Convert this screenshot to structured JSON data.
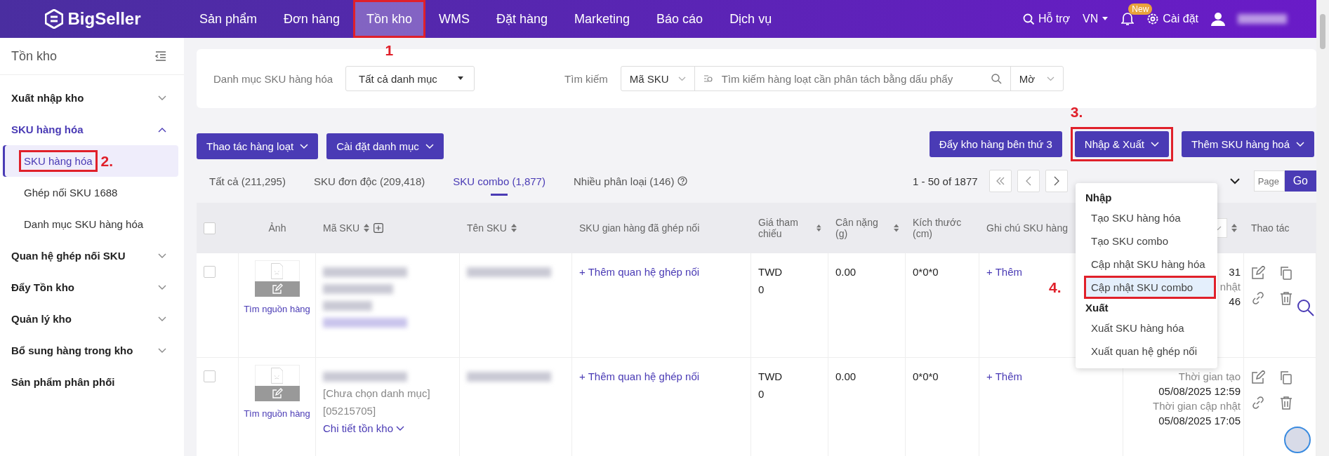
{
  "topbar": {
    "logo": "BigSeller",
    "nav": [
      {
        "label": "Sản phẩm",
        "selected": false
      },
      {
        "label": "Đơn hàng",
        "selected": false
      },
      {
        "label": "Tồn kho",
        "selected": true,
        "callout": "1"
      },
      {
        "label": "WMS",
        "selected": false
      },
      {
        "label": "Đặt hàng",
        "selected": false
      },
      {
        "label": "Marketing",
        "selected": false
      },
      {
        "label": "Báo cáo",
        "selected": false
      },
      {
        "label": "Dịch vụ",
        "selected": false
      }
    ],
    "help": "Hỗ trợ",
    "language": "VN",
    "badge": "New",
    "settings": "Cài đặt"
  },
  "sidebar": {
    "title": "Tồn kho",
    "items": [
      {
        "kind": "group",
        "label": "Xuất nhập kho",
        "expanded": false
      },
      {
        "kind": "group",
        "label": "SKU hàng hóa",
        "expanded": true,
        "children": [
          {
            "label": "SKU hàng hóa",
            "selected": true,
            "callout": "2."
          },
          {
            "label": "Ghép nối SKU 1688",
            "selected": false
          },
          {
            "label": "Danh mục SKU hàng hóa",
            "selected": false
          }
        ]
      },
      {
        "kind": "group",
        "label": "Quan hệ ghép nối SKU",
        "expanded": false
      },
      {
        "kind": "group",
        "label": "Đẩy Tồn kho",
        "expanded": false
      },
      {
        "kind": "group",
        "label": "Quản lý kho",
        "expanded": false
      },
      {
        "kind": "group",
        "label": "Bổ sung hàng trong kho",
        "expanded": false
      },
      {
        "kind": "link",
        "label": "Sản phẩm phân phối",
        "expanded": false
      }
    ]
  },
  "filters": {
    "category_label": "Danh mục SKU hàng hóa",
    "category_value": "Tất cả danh mục",
    "search_label": "Tìm kiếm",
    "search_type": "Mã SKU",
    "search_placeholder": "Tìm kiếm hàng loạt cần phân tách bằng dấu phẩy",
    "match_mode": "Mờ"
  },
  "toolbar": {
    "left": [
      {
        "label": "Thao tác hàng loạt"
      },
      {
        "label": "Cài đặt danh mục"
      }
    ],
    "right": [
      {
        "label": "Đẩy kho hàng bên thứ 3",
        "dropdown": false
      },
      {
        "label": "Nhập & Xuất",
        "dropdown": true,
        "callout": "3."
      },
      {
        "label": "Thêm SKU hàng hoá",
        "dropdown": true
      }
    ]
  },
  "tabs": [
    {
      "label": "Tất cả (211,295)",
      "selected": false,
      "help": false
    },
    {
      "label": "SKU đơn độc (209,418)",
      "selected": false,
      "help": false
    },
    {
      "label": "SKU combo (1,877)",
      "selected": true,
      "help": false
    },
    {
      "label": "Nhiều phân loại (146)",
      "selected": false,
      "help": true
    }
  ],
  "pagination": {
    "range": "1 - 50 of 1877",
    "page_placeholder": "Page",
    "go": "Go"
  },
  "menu": {
    "sections": [
      {
        "title": "Nhập",
        "items": [
          {
            "label": "Tạo SKU hàng hóa",
            "hovered": false
          },
          {
            "label": "Tạo SKU combo",
            "hovered": false
          },
          {
            "label": "Cập nhật SKU hàng hóa",
            "hovered": false
          },
          {
            "label": "Cập nhật SKU combo",
            "hovered": true,
            "callout": "4."
          }
        ]
      },
      {
        "title": "Xuất",
        "items": [
          {
            "label": "Xuất SKU hàng hóa",
            "hovered": false
          },
          {
            "label": "Xuất quan hệ ghép nối",
            "hovered": false
          }
        ]
      }
    ]
  },
  "table": {
    "all_checked": false,
    "columns": [
      {
        "label": "Ảnh",
        "sortable": false
      },
      {
        "label": "Mã SKU",
        "sortable": true
      },
      {
        "label": "Tên SKU",
        "sortable": true
      },
      {
        "label": "SKU gian hàng đã ghép nối",
        "sortable": false
      },
      {
        "label": "Giá tham chiếu",
        "sortable": true
      },
      {
        "label": "Cân nặng (g)",
        "sortable": true
      },
      {
        "label": "Kích thước (cm)",
        "sortable": false
      },
      {
        "label": "Ghi chú SKU hàng",
        "sortable": false
      },
      {
        "sortable": true
      },
      {
        "label": "Thao tác",
        "sortable": false
      }
    ],
    "rows": [
      {
        "checked": false,
        "image_link": "Tìm nguồn hàng",
        "link": "+ Thêm quan hệ ghép nối",
        "currency": "TWD",
        "price": "0",
        "weight": "0.00",
        "size": "0*0*0",
        "note": "+ Thêm",
        "times": [
          {
            "kind": "value",
            "text": "31"
          },
          {
            "kind": "label",
            "text": "nhật"
          },
          {
            "kind": "value",
            "text": "46"
          }
        ]
      },
      {
        "checked": false,
        "image_link": "Tìm nguồn hàng",
        "sku_lines": [
          "[Chưa chọn danh mục]",
          "[05215705]"
        ],
        "stock_link": "Chi tiết tồn kho",
        "link": "+ Thêm quan hệ ghép nối",
        "currency": "TWD",
        "price": "0",
        "weight": "0.00",
        "size": "0*0*0",
        "note": "+ Thêm",
        "times": [
          {
            "kind": "label",
            "text": "Thời gian tạo"
          },
          {
            "kind": "value",
            "text": "05/08/2025 12:59"
          },
          {
            "kind": "label",
            "text": "Thời gian cập nhật"
          },
          {
            "kind": "value",
            "text": "05/08/2025 17:05"
          }
        ]
      }
    ]
  }
}
